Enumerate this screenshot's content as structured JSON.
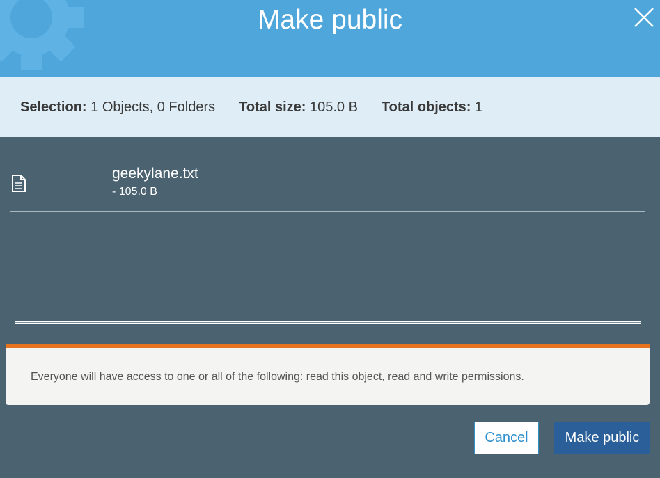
{
  "dialog": {
    "title": "Make public",
    "close_icon": "close-icon",
    "background_icon": "gear-icon"
  },
  "summary": {
    "selection_label": "Selection:",
    "selection_value": "1 Objects, 0 Folders",
    "total_size_label": "Total size:",
    "total_size_value": "105.0 B",
    "total_objects_label": "Total objects:",
    "total_objects_value": "1"
  },
  "files": [
    {
      "icon": "file-icon",
      "name": "geekylane.txt",
      "size": "- 105.0 B"
    }
  ],
  "warning": {
    "text": "Everyone will have access to one or all of the following: read this object, read and write permissions."
  },
  "buttons": {
    "cancel_label": "Cancel",
    "confirm_label": "Make public"
  },
  "colors": {
    "header": "#4ea6db",
    "summary_bg": "#deedf6",
    "body_bg": "#4b6270",
    "warning_accent": "#e8731e",
    "primary_button": "#2b5f99",
    "link_blue": "#2f90cf"
  }
}
